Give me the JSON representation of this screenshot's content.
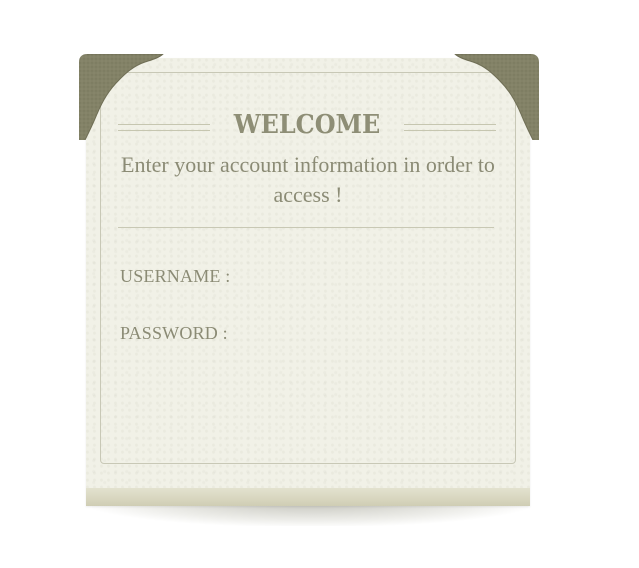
{
  "login": {
    "title": "WELCOME",
    "subtitle": "Enter your account information in order to access !",
    "username_label": "USERNAME :",
    "username_value": "",
    "password_label": "PASSWORD :",
    "password_value": ""
  },
  "colors": {
    "card_background": "#f1f1e7",
    "text": "#8b8b75",
    "corner": "#838267",
    "rule": "#c8c8b4"
  },
  "icons": {
    "corner_left": "corner-ornament-icon",
    "corner_right": "corner-ornament-icon"
  }
}
